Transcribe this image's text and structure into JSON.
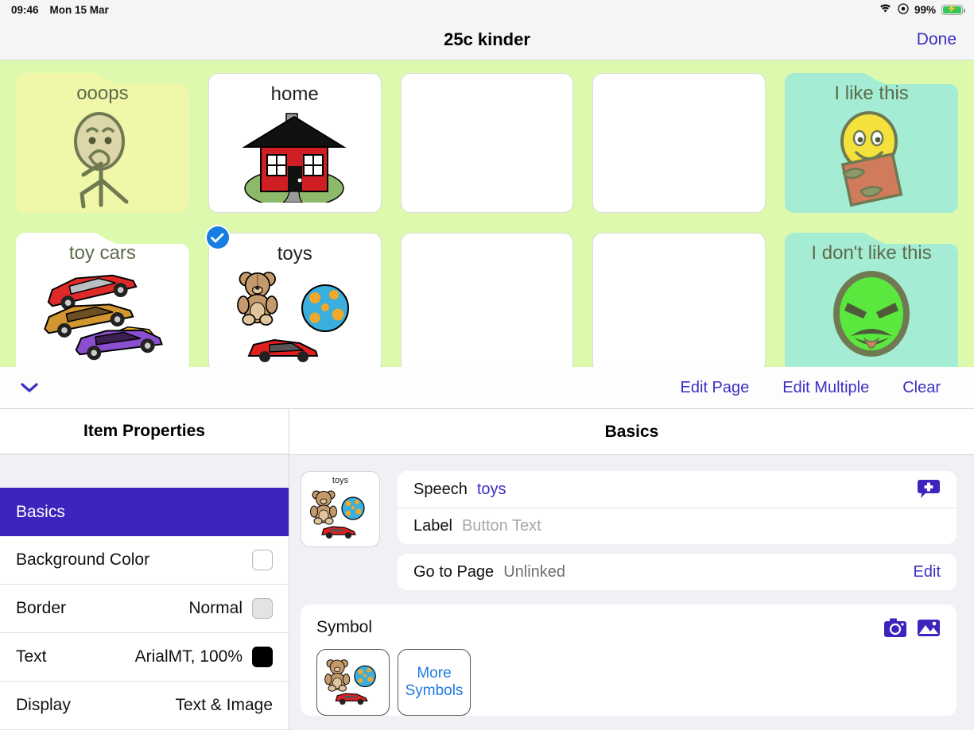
{
  "status_bar": {
    "time": "09:46",
    "date": "Mon 15 Mar",
    "battery_percent": "99%",
    "wifi_icon": "wifi-icon",
    "location_icon": "location-icon",
    "battery_icon": "battery-charging-icon"
  },
  "title_bar": {
    "title": "25c kinder",
    "done_label": "Done"
  },
  "board": {
    "background_color": "#dcf9ad",
    "cells": [
      {
        "label": "ooops",
        "type": "folder",
        "color": "#f0f7a8",
        "art": "person-covering-mouth",
        "selected": false
      },
      {
        "label": "home",
        "type": "button",
        "color": "#ffffff",
        "art": "house",
        "selected": false
      },
      {
        "label": "",
        "type": "button",
        "color": "#ffffff",
        "art": "",
        "selected": false
      },
      {
        "label": "",
        "type": "button",
        "color": "#ffffff",
        "art": "",
        "selected": false
      },
      {
        "label": "I like this",
        "type": "folder",
        "color": "#a5ecd4",
        "art": "happy-face-card",
        "selected": false
      },
      {
        "label": "toy cars",
        "type": "folder",
        "color": "#ffffff",
        "art": "three-toy-cars",
        "selected": false
      },
      {
        "label": "toys",
        "type": "button",
        "color": "#ffffff",
        "art": "bear-ball-car",
        "selected": true
      },
      {
        "label": "",
        "type": "button",
        "color": "#ffffff",
        "art": "",
        "selected": false
      },
      {
        "label": "",
        "type": "button",
        "color": "#ffffff",
        "art": "",
        "selected": false
      },
      {
        "label": "I don't like this",
        "type": "folder",
        "color": "#a5ecd4",
        "art": "angry-face",
        "selected": false
      }
    ]
  },
  "edit_toolbar": {
    "collapse_icon": "chevron-down-icon",
    "links": [
      "Edit Page",
      "Edit Multiple",
      "Clear"
    ],
    "accent_color": "#3b30c4"
  },
  "item_properties": {
    "header": "Item Properties",
    "rows": [
      {
        "label": "Basics",
        "value": "",
        "swatch": null,
        "active": true
      },
      {
        "label": "Background Color",
        "value": "",
        "swatch": "white",
        "active": false
      },
      {
        "label": "Border",
        "value": "Normal",
        "swatch": "grey",
        "active": false
      },
      {
        "label": "Text",
        "value": "ArialMT, 100%",
        "swatch": "black",
        "active": false
      },
      {
        "label": "Display",
        "value": "Text & Image",
        "swatch": null,
        "active": false
      }
    ]
  },
  "basics_panel": {
    "header": "Basics",
    "preview_label": "toys",
    "fields": [
      {
        "key": "Speech",
        "value": "toys",
        "value_style": "accent",
        "action": "",
        "action_icon": "speech-bubble-plus-icon"
      },
      {
        "key": "Label",
        "value": "Button Text",
        "value_style": "placeholder",
        "action": "",
        "action_icon": ""
      }
    ],
    "go_to_page": {
      "key": "Go to Page",
      "value": "Unlinked",
      "action_label": "Edit"
    },
    "symbol": {
      "title": "Symbol",
      "camera_icon": "camera-icon",
      "photo_icon": "photo-library-icon",
      "more_symbols_label": "More Symbols",
      "accent_color": "#3b25bd"
    }
  }
}
